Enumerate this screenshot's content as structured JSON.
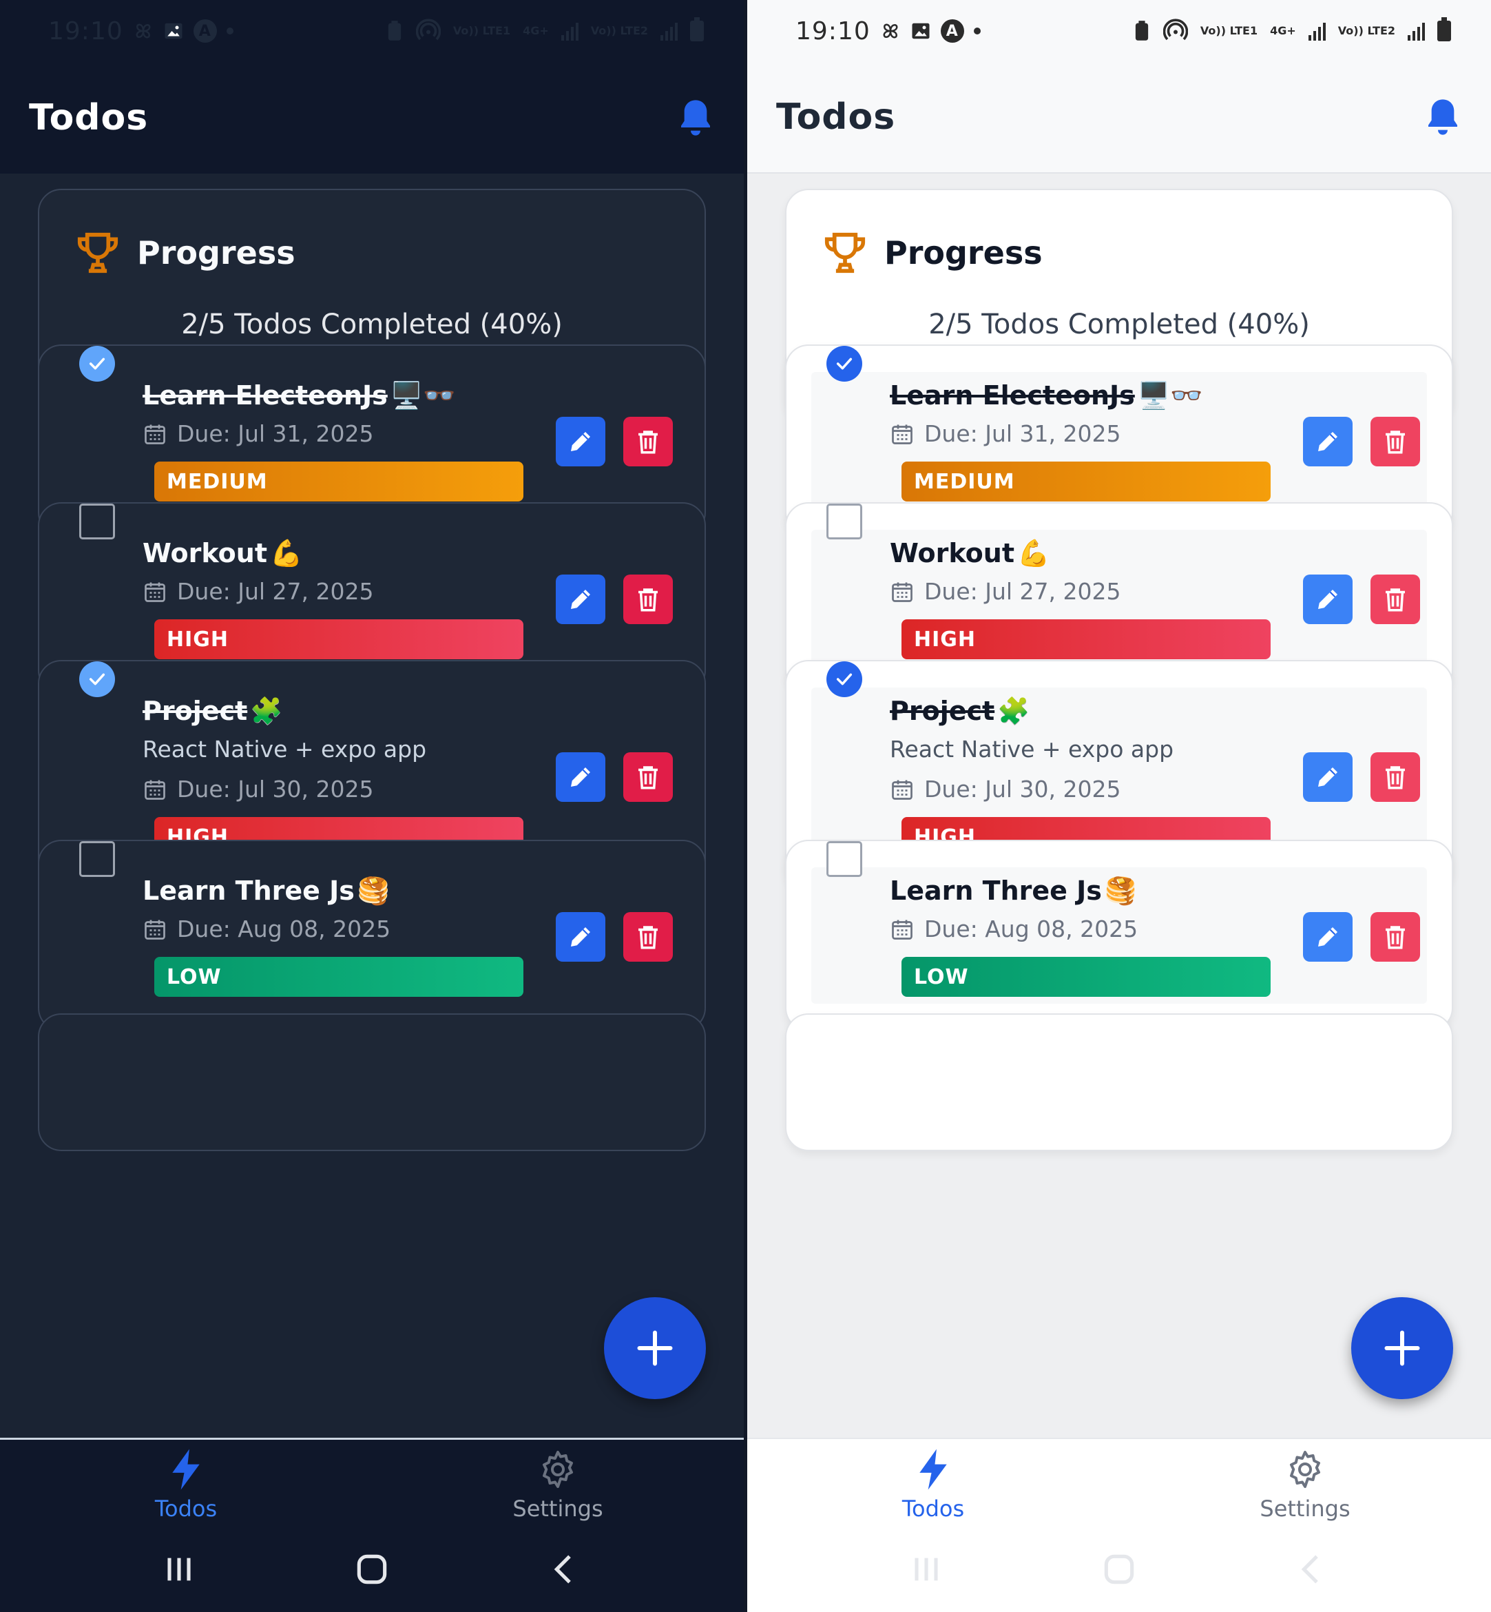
{
  "status_bar": {
    "time": "19:10",
    "net1": "Vo)) LTE1",
    "net_type": "4G+",
    "net2": "Vo)) LTE2"
  },
  "header": {
    "title": "Todos"
  },
  "progress": {
    "title": "Progress",
    "summary": "2/5 Todos Completed (40%)",
    "fraction": 0.4
  },
  "todos": [
    {
      "title": "Learn ElecteonJs",
      "emoji": "🖥️👓",
      "description": "",
      "due": "Due: Jul 31, 2025",
      "priority": "MEDIUM",
      "completed": true
    },
    {
      "title": "Workout",
      "emoji": "💪",
      "description": "",
      "due": "Due: Jul 27, 2025",
      "priority": "HIGH",
      "completed": false
    },
    {
      "title": "Project",
      "emoji": "🧩",
      "description": "React Native + expo app",
      "due": "Due: Jul 30, 2025",
      "priority": "HIGH",
      "completed": true
    },
    {
      "title": "Learn Three Js",
      "emoji": "🥞",
      "description": "",
      "due": "Due: Aug 08, 2025",
      "priority": "LOW",
      "completed": false
    }
  ],
  "tabs": [
    {
      "label": "Todos",
      "icon": "lightning-icon",
      "active": true
    },
    {
      "label": "Settings",
      "icon": "gear-icon",
      "active": false
    }
  ],
  "colors": {
    "accent": "#2563eb",
    "priority_medium": "#f59e0b",
    "priority_high": "#ef4360",
    "priority_low": "#10b981",
    "trophy": "#d97706",
    "bell": "#2563eb"
  }
}
